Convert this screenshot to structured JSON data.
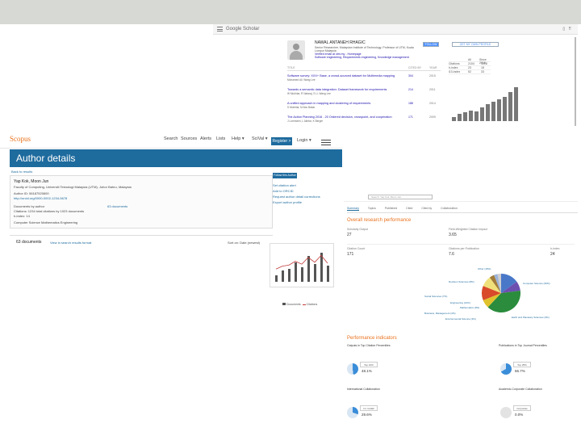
{
  "google_scholar": {
    "logo": "Google Scholar",
    "header_right": [
      "▯",
      "⠿"
    ],
    "profile_name": "NAWAL ANTANEH RHAGIC",
    "affiliation": "Senior Researcher, Malaysian Institute of Technology; Professor of UTM, Kuala Lumpur Malaysia",
    "verified": "Verified email at utm.my - Homepage",
    "keywords": "Software engineering, Requirements engineering, Knowledge management",
    "follow_button": "FOLLOW",
    "get_alerts": "GET MY OWN PROFILE",
    "tabs": [
      "TITLE",
      "CITED BY",
      "YEAR"
    ],
    "articles": [
      {
        "title": "Software survey: XXX+ Base, a crowd-sourced dataset for Multimedia mapping",
        "authors": "Mohamed Ali, Wang Lee",
        "cited": "304",
        "year": "2015"
      },
      {
        "title": "Towards a semantic data integration: Dataset framework for requirements",
        "authors": "W Mukhtar, R Nataraj, S Li, Wang Lee",
        "cited": "214",
        "year": "2011"
      },
      {
        "title": "A unified approach in mapping and clustering of requirements",
        "authors": "S Mukhtar, M Abu Bakar",
        "cited": "188",
        "year": "2014"
      },
      {
        "title": "The Action Planning 2016 - 20 Ordered decision, crosspoint, and cooperation",
        "authors": "J Lorentzen, L Akhtar, K Berger",
        "cited": "171",
        "year": "2009"
      }
    ],
    "stats_head": [
      "All",
      "Since 2016"
    ],
    "stats": [
      {
        "label": "Citations",
        "all": "2104",
        "since": "1218"
      },
      {
        "label": "h-index",
        "all": "23",
        "since": "18"
      },
      {
        "label": "i10-index",
        "all": "52",
        "since": "33"
      }
    ],
    "chart_bars": [
      0.12,
      0.2,
      0.25,
      0.3,
      0.28,
      0.38,
      0.48,
      0.55,
      0.62,
      0.68,
      0.82,
      0.95
    ]
  },
  "scopus": {
    "logo": "Scopus",
    "nav": [
      "Search",
      "Sources",
      "Alerts",
      "Lists",
      "Help ▾",
      "SciVal ▾"
    ],
    "register": "Register >",
    "login": "Login ▾",
    "page_title": "Author details",
    "back_link": "Back to results",
    "author_name": "Yap Kok, Moon Jun",
    "author_affil": "Faculty of Computing, Universiti Teknologi Malaysia (UTM), Johor Bahru, Malaysia",
    "author_id": "Author ID: 56187520600",
    "orcid": "http://orcid.org/0000-0002-1234-5678",
    "documents_label": "Documents by author",
    "docs_summary": "63 documents",
    "h_index": "h-index: 14",
    "citations_line": "Citations: 1234 total citations by 1023 documents",
    "subject": "Computer Science  Mathematics  Engineering",
    "docs_tab": "63 documents",
    "view_in_results": "View in search results format",
    "sort_label": "Sort on: Date (newest)",
    "follow_btn": "Follow this Author",
    "links": [
      "Set citation alert",
      "Add to ORCID",
      "Request author detail corrections",
      "Export author profile"
    ],
    "legend_docs": "Documents",
    "legend_cit": "Citations",
    "chart_bars": [
      0.2,
      0.35,
      0.4,
      0.6,
      0.45,
      0.8,
      0.55,
      0.9,
      0.5
    ]
  },
  "scival": {
    "search_placeholder": "Search: Yap Kok, Moon Jun",
    "tabs": [
      "Summary",
      "Topics",
      "Published",
      "Cited",
      "Cited by",
      "Collaboration"
    ],
    "overall_heading": "Overall research performance",
    "metrics": [
      {
        "label": "Scholarly Output",
        "value": "27"
      },
      {
        "label": "Field-Weighted Citation Impact",
        "value": "3.65"
      },
      {
        "label": "Citation Count",
        "value": "171"
      },
      {
        "label": "Citations per Publication",
        "value": "7.6"
      },
      {
        "label": "h-index",
        "value": "24"
      }
    ],
    "pie_labels": [
      "Other (15%)",
      "Decision Sciences (8%)",
      "Computer Science (39%)",
      "Social Sciences (7%)",
      "Engineering (12%)",
      "Mathematics (9%)",
      "Business, Management (4%)",
      "Earth and Planetary Sciences (3%)",
      "Environmental Science (3%)"
    ],
    "pie_colors": [
      "#4a78c8",
      "#6d4fb0",
      "#2a8c3c",
      "#e0c22c",
      "#d84a2a",
      "#f0e07a",
      "#a27c3a",
      "#9bb3d9",
      "#cfcfcf"
    ],
    "perf_heading": "Performance indicators",
    "indicators": [
      {
        "title": "Outputs in Top Citation Percentiles",
        "pct": "48.1%",
        "box": "Top 10%"
      },
      {
        "title": "Publications in Top Journal Percentiles",
        "pct": "66.7%",
        "box": "Top 25%"
      },
      {
        "title": "International Collaboration",
        "pct": "29.6%",
        "box": "Int. Collab"
      },
      {
        "title": "Academic-Corporate Collaboration",
        "pct": "0.0%",
        "box": "Corporate"
      }
    ]
  }
}
